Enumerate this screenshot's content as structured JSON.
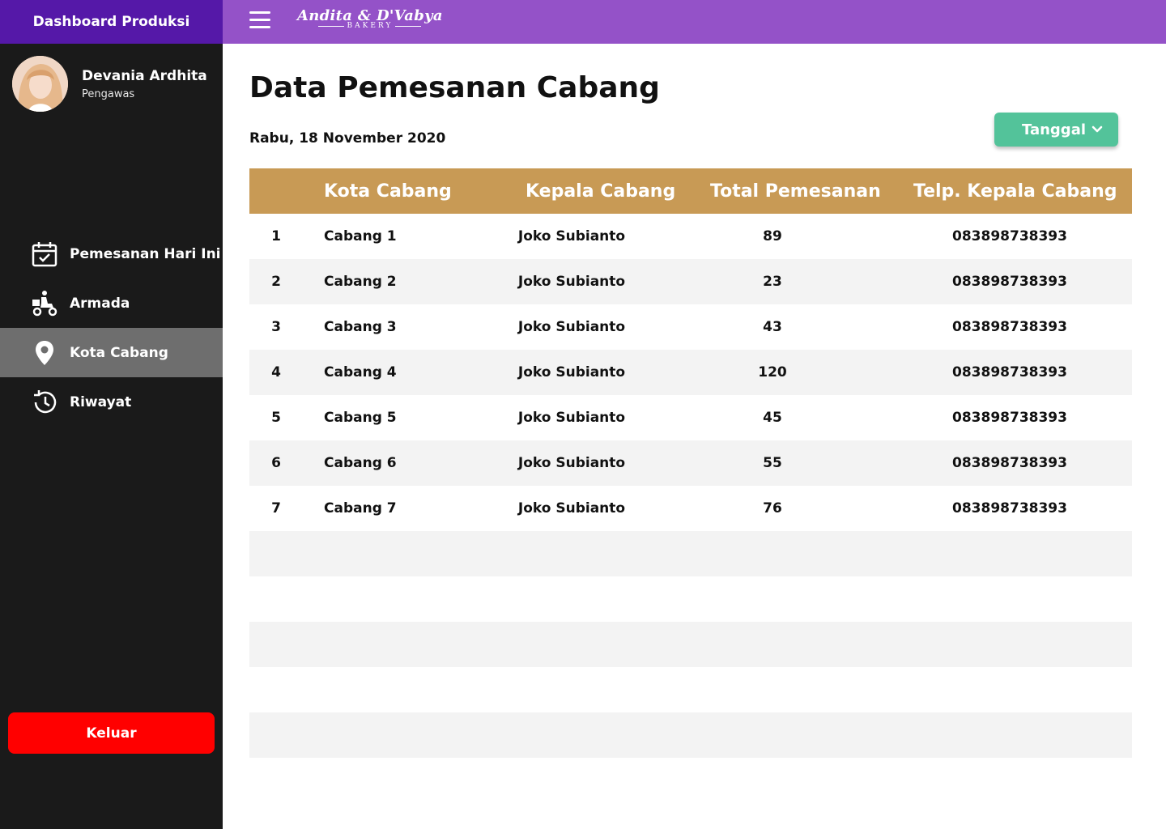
{
  "sidebar": {
    "title": "Dashboard Produksi",
    "user": {
      "name": "Devania Ardhita",
      "role": "Pengawas"
    },
    "items": [
      {
        "label": "Pemesanan Hari Ini",
        "icon": "calendar-check-icon"
      },
      {
        "label": "Armada",
        "icon": "delivery-scooter-icon"
      },
      {
        "label": "Kota Cabang",
        "icon": "location-pin-icon",
        "active": true
      },
      {
        "label": "Riwayat",
        "icon": "history-icon"
      }
    ],
    "logout_label": "Keluar"
  },
  "topbar": {
    "brand_name": "Andita & D'Vabya",
    "brand_sub": "BAKERY"
  },
  "main": {
    "title": "Data Pemesanan Cabang",
    "date": "Rabu, 18 November 2020",
    "date_filter_label": "Tanggal"
  },
  "table": {
    "headers": [
      "Kota Cabang",
      "Kepala Cabang",
      "Total Pemesanan",
      "Telp. Kepala Cabang"
    ],
    "rows": [
      {
        "no": "1",
        "kota": "Cabang 1",
        "kepala": "Joko Subianto",
        "total": "89",
        "telp": "083898738393"
      },
      {
        "no": "2",
        "kota": "Cabang 2",
        "kepala": "Joko Subianto",
        "total": "23",
        "telp": "083898738393"
      },
      {
        "no": "3",
        "kota": "Cabang 3",
        "kepala": "Joko Subianto",
        "total": "43",
        "telp": "083898738393"
      },
      {
        "no": "4",
        "kota": "Cabang 4",
        "kepala": "Joko Subianto",
        "total": "120",
        "telp": "083898738393"
      },
      {
        "no": "5",
        "kota": "Cabang 5",
        "kepala": "Joko Subianto",
        "total": "45",
        "telp": "083898738393"
      },
      {
        "no": "6",
        "kota": "Cabang 6",
        "kepala": "Joko Subianto",
        "total": "55",
        "telp": "083898738393"
      },
      {
        "no": "7",
        "kota": "Cabang 7",
        "kepala": "Joko Subianto",
        "total": "76",
        "telp": "083898738393"
      }
    ]
  },
  "colors": {
    "sidebar_bg": "#1a1a1a",
    "sidebar_header": "#5518a8",
    "topbar": "#9452c8",
    "table_header": "#c89a55",
    "active_item": "#6e6e6e",
    "dropdown": "#53c39a",
    "logout": "#ff0000"
  }
}
